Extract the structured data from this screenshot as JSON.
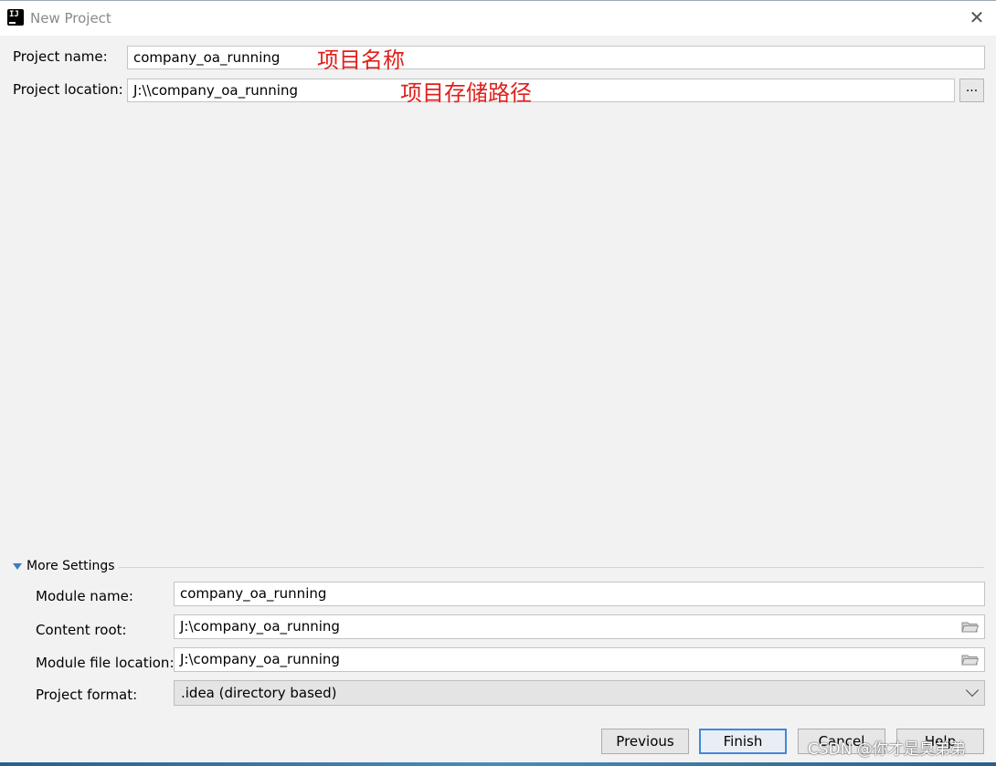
{
  "window": {
    "title": "New Project"
  },
  "form": {
    "project_name_label": "Project name:",
    "project_name_value": "company_oa_running",
    "project_location_label": "Project location:",
    "project_location_value": "J:\\\\company_oa_running",
    "browse_label": "..."
  },
  "annotations": {
    "name_note": "项目名称",
    "location_note": "项目存储路径"
  },
  "more_settings": {
    "label": "More Settings",
    "module_name_label": "Module name:",
    "module_name_value": "company_oa_running",
    "content_root_label": "Content root:",
    "content_root_value": "J:\\company_oa_running",
    "module_file_location_label": "Module file location:",
    "module_file_location_value": "J:\\company_oa_running",
    "project_format_label": "Project format:",
    "project_format_value": ".idea (directory based)"
  },
  "buttons": {
    "previous": "Previous",
    "finish": "Finish",
    "cancel": "Cancel",
    "help": "Help"
  },
  "watermark": "CSDN @你才是臭弟弟",
  "colors": {
    "annotation": "#e0201c",
    "accent": "#3f8ad9"
  }
}
